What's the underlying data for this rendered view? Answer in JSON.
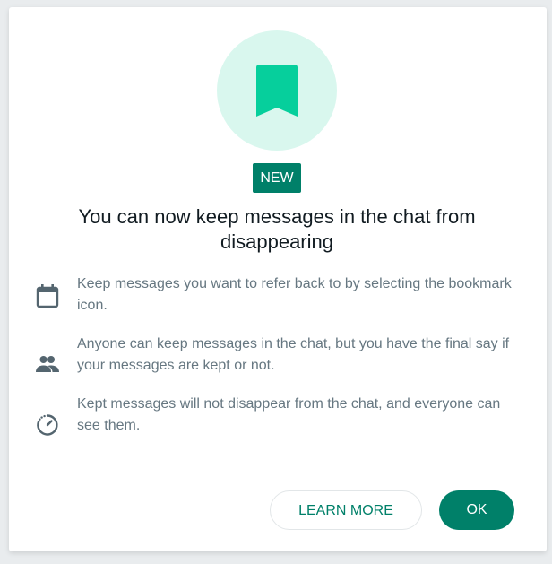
{
  "dialog": {
    "badge": "NEW",
    "title": "You can now keep messages in the chat from disappearing",
    "features": [
      {
        "icon": "calendar-icon",
        "text": "Keep messages you want to refer back to by selecting the bookmark icon."
      },
      {
        "icon": "people-icon",
        "text": "Anyone can keep messages in the chat, but you have the final say if your messages are kept or not."
      },
      {
        "icon": "disappearing-timer-icon",
        "text": "Kept messages will not disappear from the chat, and everyone can see them."
      }
    ],
    "buttons": {
      "learn_more": "LEARN MORE",
      "ok": "OK"
    }
  },
  "colors": {
    "accent": "#008069",
    "bookmark": "#06cf9c",
    "hero_bg": "#d9f7ee",
    "body_text": "#667781",
    "title_text": "#111b21"
  }
}
